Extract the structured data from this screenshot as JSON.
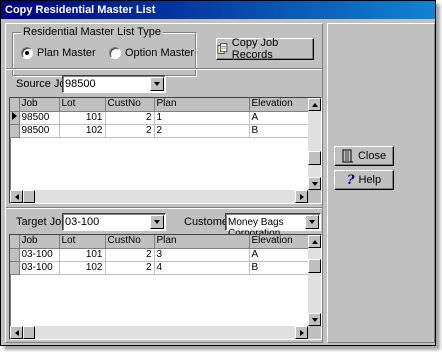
{
  "window": {
    "title": "Copy Residential Master List"
  },
  "list_type": {
    "legend": "Residential Master List Type",
    "options": [
      {
        "label": "Plan Master",
        "checked": true
      },
      {
        "label": "Option Master",
        "checked": false
      }
    ]
  },
  "buttons": {
    "copy_job_records": "Copy Job Records",
    "close": "Close",
    "help": "Help"
  },
  "source": {
    "label": "Source Job:",
    "value": "98500",
    "columns": [
      "Job",
      "Lot",
      "CustNo",
      "Plan",
      "Elevation"
    ],
    "rows": [
      {
        "job": "98500",
        "lot": "101",
        "custno": "2",
        "plan": "1",
        "elevation": "A"
      },
      {
        "job": "98500",
        "lot": "102",
        "custno": "2",
        "plan": "2",
        "elevation": "B"
      }
    ]
  },
  "target": {
    "label": "Target Job:",
    "value": "03-100",
    "customer_label": "Customer:",
    "customer_value": "Money Bags Corporation",
    "columns": [
      "Job",
      "Lot",
      "CustNo",
      "Plan",
      "Elevation"
    ],
    "rows": [
      {
        "job": "03-100",
        "lot": "101",
        "custno": "2",
        "plan": "3",
        "elevation": "A"
      },
      {
        "job": "03-100",
        "lot": "102",
        "custno": "2",
        "plan": "4",
        "elevation": "B"
      }
    ]
  },
  "icons": [
    "door-exit-icon",
    "question-mark-icon",
    "copy-job-icon",
    "drop-down-arrow-icon"
  ]
}
